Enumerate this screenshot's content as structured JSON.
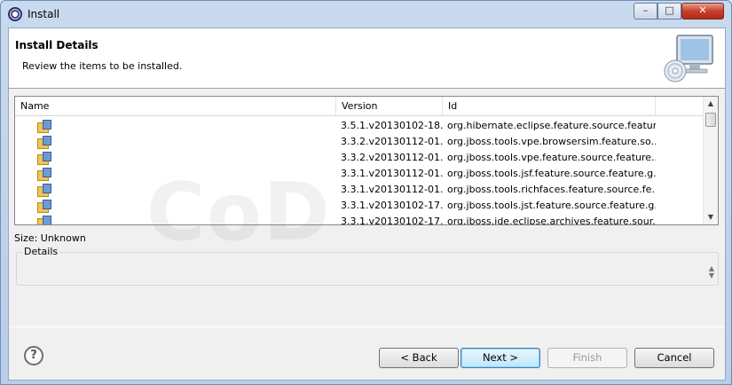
{
  "window": {
    "title": "Install",
    "controls": {
      "minimize": "–",
      "maximize": "□",
      "close": "✕"
    }
  },
  "header": {
    "title": "Install Details",
    "description": "Review the items to be installed.",
    "icon": "computer-cd-icon"
  },
  "table": {
    "columns": [
      "Name",
      "Version",
      "Id"
    ],
    "rows": [
      {
        "name": "",
        "icon": "feature-package-icon",
        "version": "3.5.1.v20130102-18...",
        "id": "org.hibernate.eclipse.feature.source.featur..."
      },
      {
        "name": "",
        "icon": "feature-package-icon",
        "version": "3.3.2.v20130112-01...",
        "id": "org.jboss.tools.vpe.browsersim.feature.so..."
      },
      {
        "name": "",
        "icon": "feature-package-icon",
        "version": "3.3.2.v20130112-01...",
        "id": "org.jboss.tools.vpe.feature.source.feature...."
      },
      {
        "name": "",
        "icon": "feature-package-icon",
        "version": "3.3.1.v20130112-01...",
        "id": "org.jboss.tools.jsf.feature.source.feature.g..."
      },
      {
        "name": "",
        "icon": "feature-package-icon",
        "version": "3.3.1.v20130112-01...",
        "id": "org.jboss.tools.richfaces.feature.source.fe..."
      },
      {
        "name": "",
        "icon": "feature-package-icon",
        "version": "3.3.1.v20130102-17...",
        "id": "org.jboss.tools.jst.feature.source.feature.g..."
      },
      {
        "name": "",
        "icon": "feature-package-icon",
        "version": "3.3.1.v20130102-17...",
        "id": "org.jboss.ide.eclipse.archives.feature.sour..."
      }
    ]
  },
  "size_label": "Size: Unknown",
  "details": {
    "label": "Details"
  },
  "buttons": {
    "back": "< Back",
    "next": "Next >",
    "finish": "Finish",
    "cancel": "Cancel"
  },
  "help": "?",
  "watermark": "CoD"
}
